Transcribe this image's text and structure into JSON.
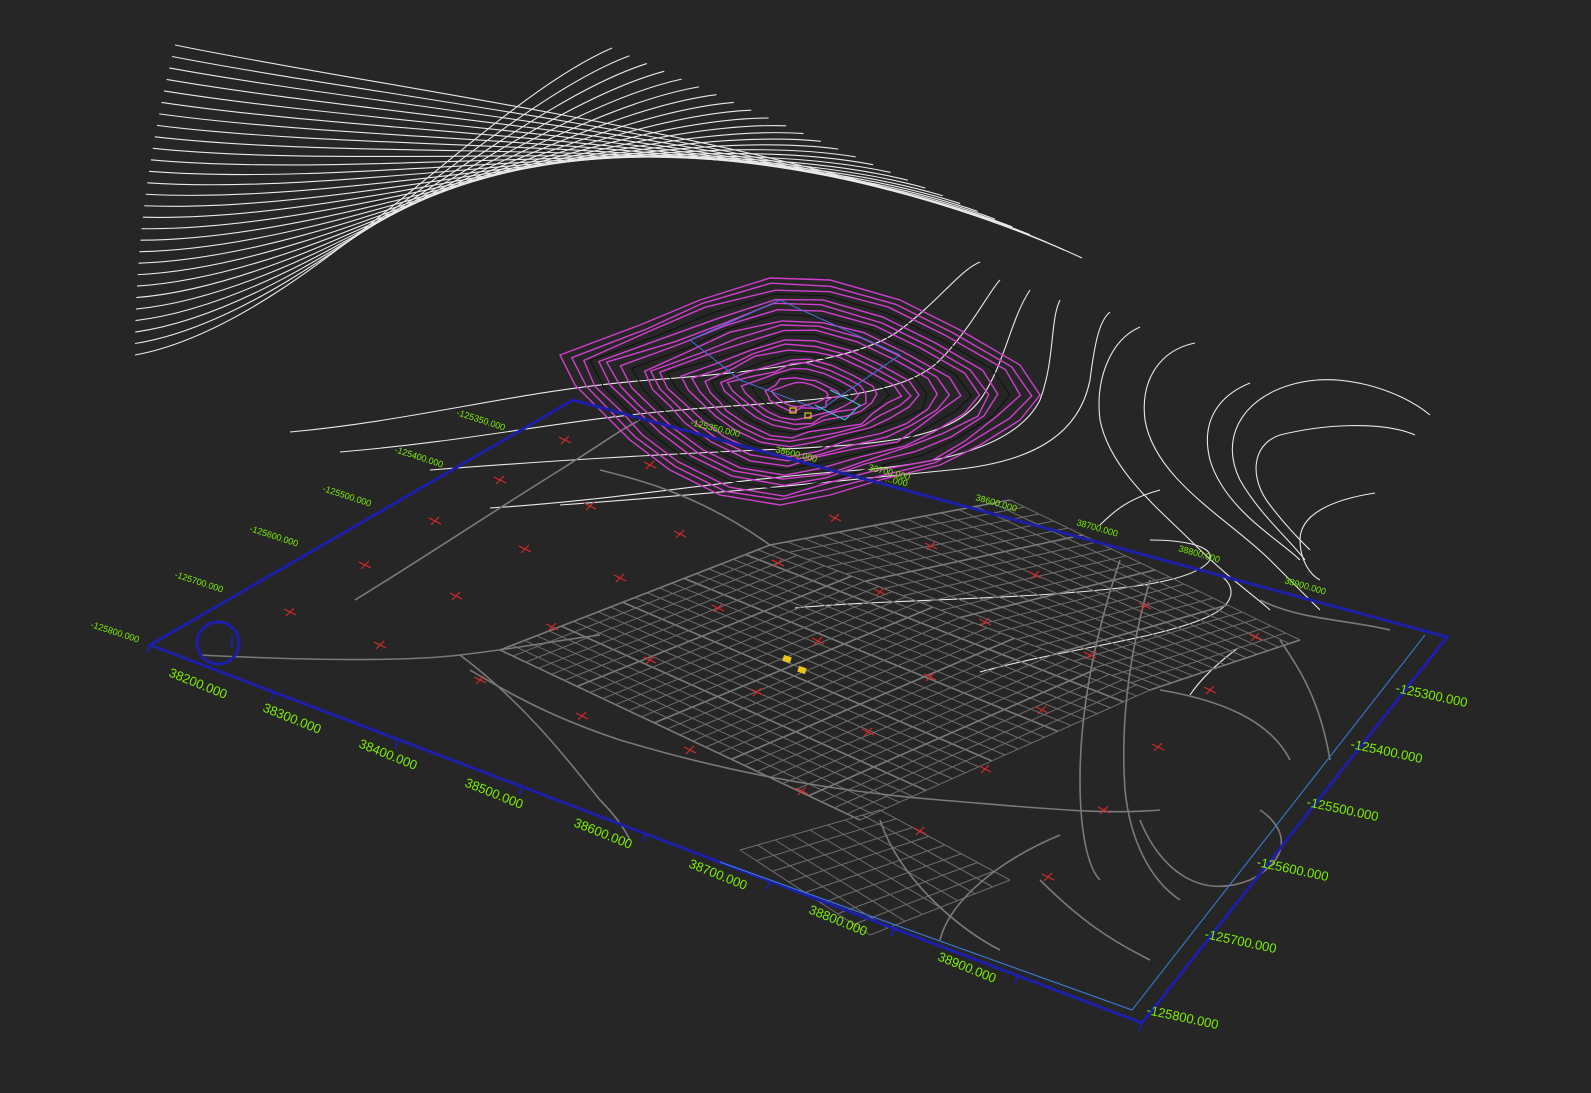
{
  "colors": {
    "background": "#262626",
    "label_green": "#7cf000",
    "frame_blue": "#1d1fa8",
    "frame_inner_blue": "#3b7fe0",
    "contour_white": "#e9e9e9",
    "survey_magenta": "#d13fcf",
    "street_gray": "#6e6e6e",
    "marker_red": "#d42a2a",
    "building_yellow": "#e8c619"
  },
  "axes": {
    "bottom_x": [
      "38200.000",
      "38300.000",
      "38400.000",
      "38500.000",
      "38600.000",
      "38700.000",
      "38800.000",
      "38900.000"
    ],
    "left_y": [
      "-125800.000",
      "-125700.000",
      "-125600.000",
      "-125500.000",
      "-125400.000",
      "-125350.000"
    ],
    "top_x": [
      "38600.000",
      "38700.000",
      "38800.000",
      "38900.000"
    ],
    "right_y": [
      "-125300.000",
      "-125400.000",
      "-125500.000",
      "-125600.000",
      "-125700.000",
      "-125800.000"
    ],
    "survey_labels": [
      "-125350.000",
      "38600.000",
      "38700.000",
      "...000"
    ]
  },
  "icons": {
    "marker": "red-cross-marker-icon",
    "building": "yellow-building-icon",
    "origin": "north-circle-icon"
  }
}
